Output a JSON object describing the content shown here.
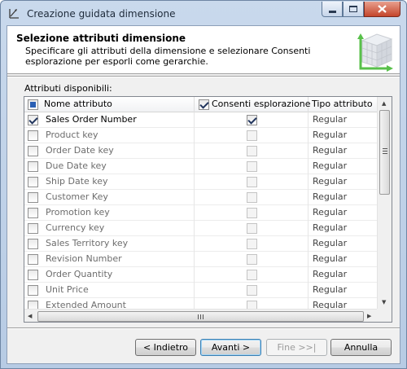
{
  "window": {
    "title": "Creazione guidata dimensione"
  },
  "header": {
    "title": "Selezione attributi dimensione",
    "description": "Specificare gli attributi della dimensione e selezionare Consenti esplorazione per esporli come gerarchie."
  },
  "grid": {
    "label": "Attributi disponibili:",
    "columns": {
      "name": "Nome attributo",
      "browse": "Consenti esplorazione",
      "type": "Tipo attributo"
    },
    "rows": [
      {
        "name": "Sales Order Number",
        "checked": true,
        "browse": true,
        "type": "Regular"
      },
      {
        "name": "Product key",
        "checked": false,
        "browse": false,
        "type": "Regular"
      },
      {
        "name": "Order Date key",
        "checked": false,
        "browse": false,
        "type": "Regular"
      },
      {
        "name": "Due Date key",
        "checked": false,
        "browse": false,
        "type": "Regular"
      },
      {
        "name": "Ship Date key",
        "checked": false,
        "browse": false,
        "type": "Regular"
      },
      {
        "name": "Customer Key",
        "checked": false,
        "browse": false,
        "type": "Regular"
      },
      {
        "name": "Promotion key",
        "checked": false,
        "browse": false,
        "type": "Regular"
      },
      {
        "name": "Currency key",
        "checked": false,
        "browse": false,
        "type": "Regular"
      },
      {
        "name": "Sales Territory key",
        "checked": false,
        "browse": false,
        "type": "Regular"
      },
      {
        "name": "Revision Number",
        "checked": false,
        "browse": false,
        "type": "Regular"
      },
      {
        "name": "Order Quantity",
        "checked": false,
        "browse": false,
        "type": "Regular"
      },
      {
        "name": "Unit Price",
        "checked": false,
        "browse": false,
        "type": "Regular"
      },
      {
        "name": "Extended Amount",
        "checked": false,
        "browse": false,
        "type": "Regular"
      }
    ]
  },
  "buttons": {
    "back": "< Indietro",
    "next": "Avanti >",
    "finish": "Fine >>|",
    "cancel": "Annulla"
  },
  "icons": {
    "app": "wizard-icon",
    "header": "dimension-cube-icon"
  }
}
